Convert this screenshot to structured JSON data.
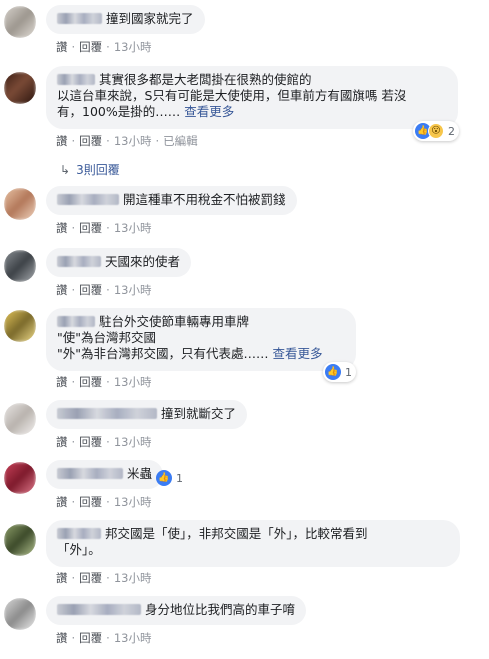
{
  "actions": {
    "like": "讚",
    "reply": "回覆",
    "separator": "·"
  },
  "comments": [
    {
      "text": "撞到國家就完了",
      "time": "13小時"
    },
    {
      "text_lines": [
        "其實很多都是大老闆掛在很熟的使館的",
        "以這台車來說，S只有可能是大使使用，但車前方有國旗嗎 若沒",
        "有，100%是掛的……"
      ],
      "more": "查看更多",
      "time": "13小時",
      "edited": "已編輯",
      "reaction_count": "2"
    },
    {
      "text": "開這種車不用稅金不怕被罰錢",
      "time": "13小時"
    },
    {
      "text": "天國來的使者",
      "time": "13小時"
    },
    {
      "text_lines": [
        "駐台外交使節車輛專用車牌",
        "\"使\"為台灣邦交國",
        "\"外\"為非台灣邦交國，只有代表處……"
      ],
      "more": "查看更多",
      "time": "13小時",
      "reaction_count": "1"
    },
    {
      "text": "撞到就斷交了",
      "time": "13小時"
    },
    {
      "text": "米蟲",
      "time": "13小時",
      "reaction_count": "1"
    },
    {
      "text_lines": [
        "邦交國是「使」，非邦交國是「外」，比較常看到",
        "「外」。"
      ],
      "time": "13小時"
    },
    {
      "text": "身分地位比我們高的車子唷",
      "time": "13小時"
    }
  ],
  "replies_link": "3則回覆",
  "icons": {
    "like": "like-icon",
    "wow": "wow-icon",
    "reply_arrow": "reply-arrow-icon"
  }
}
